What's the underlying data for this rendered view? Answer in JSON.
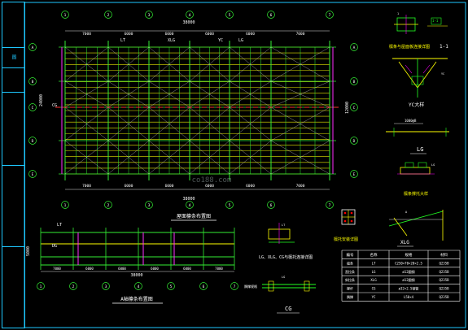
{
  "drawing": {
    "title_block_text": "图",
    "plan": {
      "title": "屋面檩条布置图",
      "total_dim": "38000",
      "bays": [
        "7000",
        "6000",
        "6000",
        "6000",
        "6000",
        "7000"
      ],
      "top_labels": [
        "LT",
        "XLG",
        "YC",
        "LG"
      ],
      "side_left": [
        "6000",
        "24000",
        "6000"
      ],
      "side_right": [
        "6000",
        "12000",
        "6000"
      ],
      "left_mark": "CG",
      "axis_top": [
        "1",
        "2",
        "3",
        "4",
        "5",
        "6",
        "7"
      ],
      "axis_left": [
        "A",
        "B",
        "C",
        "D",
        "E"
      ],
      "watermark": "co188.com"
    },
    "elevation": {
      "title": "A轴檩条布置图",
      "labels": [
        "LT",
        "DG"
      ],
      "dim_left": "5000",
      "bays": [
        "7000",
        "6000",
        "6000",
        "6000",
        "6000",
        "7000"
      ],
      "total": "38000"
    },
    "details": {
      "d1_title": "檩条与屋面板连接详图",
      "d1_mark": "1-1",
      "d2_title": "YC大样",
      "d3_title": "LG",
      "d3_dim": "1000@B",
      "d4_title": "檩条撑托大样",
      "d5_title": "LG、XLG、CG与檩托连接详图",
      "d6_title": "檩托安装详图",
      "d7_title": "XLG",
      "d8_title": "CG",
      "d8_dim": "隅撑规格"
    },
    "table": {
      "headers": [
        "编号",
        "名称",
        "规格",
        "材料"
      ],
      "rows": [
        [
          "檩条",
          "LT",
          "C250×70×20×2.5",
          "Q235B"
        ],
        [
          "直拉条",
          "LG",
          "ø12圆钢",
          "Q235B"
        ],
        [
          "斜拉条",
          "XLG",
          "ø12圆钢",
          "Q235B"
        ],
        [
          "撑杆",
          "CG",
          "ø32×2.5钢管",
          "Q235B"
        ],
        [
          "隅撑",
          "YC",
          "L50×4",
          "Q235B"
        ]
      ]
    }
  }
}
